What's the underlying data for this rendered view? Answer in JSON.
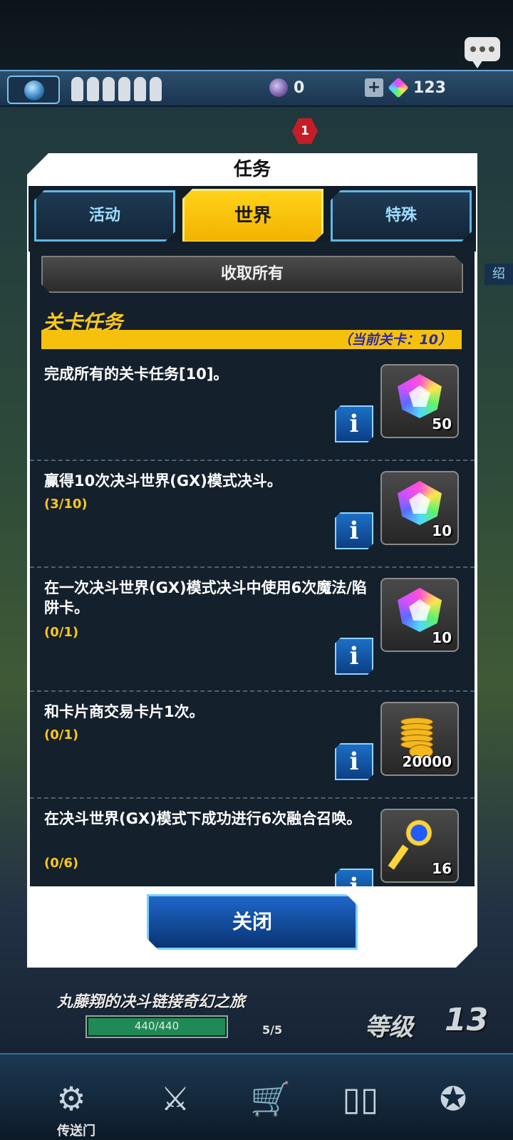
{
  "top_bar": {
    "cur1_value": "0",
    "cur2_value": "123",
    "plus": "+",
    "stamina_count": 6,
    "notification_badge": "1",
    "side_label": "绍"
  },
  "modal": {
    "title": "任务",
    "tabs": [
      {
        "label": "活动",
        "active": false
      },
      {
        "label": "世界",
        "active": true
      },
      {
        "label": "特殊",
        "active": false
      }
    ],
    "collect_all": "收取所有",
    "section_title": "关卡任务",
    "section_note": "（当前关卡：10）",
    "info_glyph": "i",
    "quests": [
      {
        "text": "完成所有的关卡任务[10]。",
        "progress": "",
        "reward_icon": "gem-icon",
        "reward_amount": "50"
      },
      {
        "text": "赢得10次决斗世界(GX)模式决斗。",
        "progress": "(3/10)",
        "reward_icon": "gem-icon",
        "reward_amount": "10"
      },
      {
        "text": "在一次决斗世界(GX)模式决斗中使用6次魔法/陷阱卡。",
        "progress": "(0/1)",
        "reward_icon": "gem-icon",
        "reward_amount": "10"
      },
      {
        "text": "和卡片商交易卡片1次。",
        "progress": "(0/1)",
        "reward_icon": "gold-coins-icon",
        "reward_amount": "20000"
      },
      {
        "text": "在决斗世界(GX)模式下成功进行6次融合召唤。",
        "progress": "(0/6)",
        "reward_icon": "key-icon",
        "reward_amount": "16"
      }
    ],
    "close_label": "关闭"
  },
  "bottom": {
    "campaign_title": "丸藤翔的决斗链接奇幻之旅",
    "xp_text": "440/440",
    "xp_fraction": 1.0,
    "chest_count": "5/5",
    "level_label": "等级",
    "level_value": "13",
    "nav_label": "传送门"
  },
  "colors": {
    "accent_yellow": "#f6c10c",
    "panel_bg": "#14202c",
    "tab_border": "#5fb7e4",
    "progress_text": "#ffc81a",
    "close_blue": "#1f66c8"
  }
}
